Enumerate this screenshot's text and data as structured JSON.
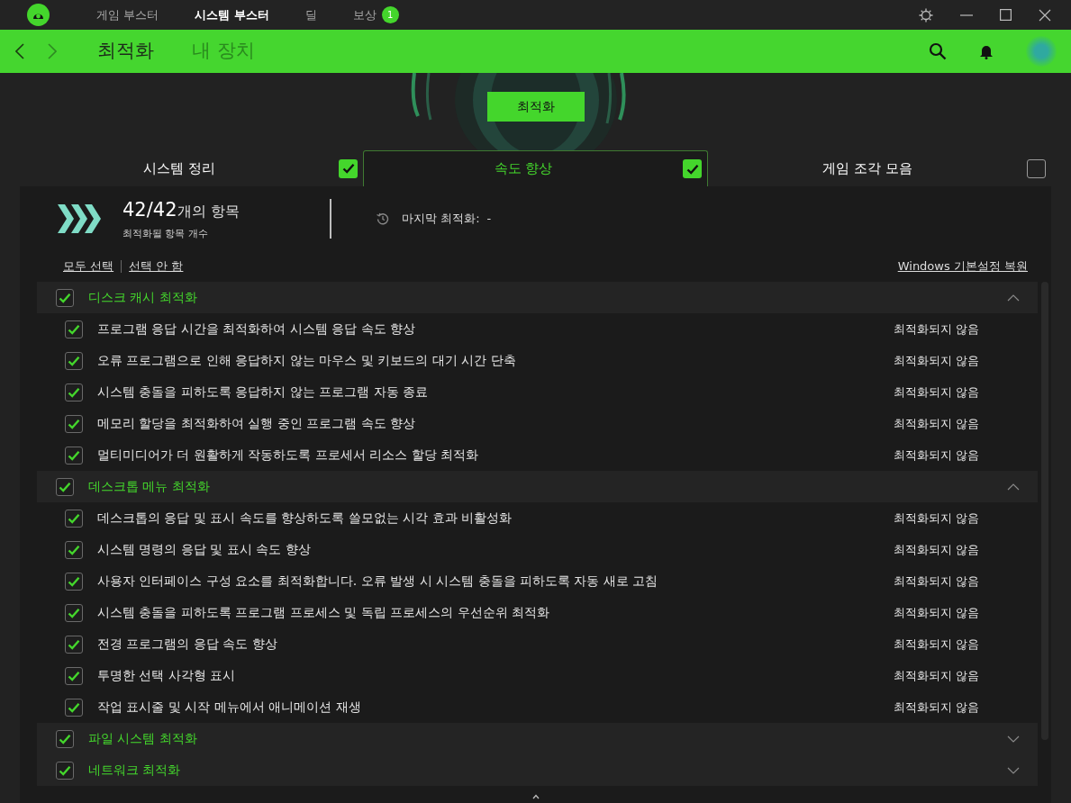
{
  "top_nav": [
    {
      "label": "게임 부스터",
      "selected": false
    },
    {
      "label": "시스템 부스터",
      "selected": true
    },
    {
      "label": "딜",
      "selected": false
    },
    {
      "label": "보상",
      "selected": false,
      "badge": "1"
    }
  ],
  "sub_nav": [
    {
      "label": "최적화",
      "selected": true
    },
    {
      "label": "내 장치",
      "selected": false
    }
  ],
  "optimize_button": "최적화",
  "tabs": [
    {
      "label": "시스템 정리",
      "selected": false,
      "checked": true
    },
    {
      "label": "속도 향상",
      "selected": true,
      "checked": true
    },
    {
      "label": "게임 조각 모음",
      "selected": false,
      "checked": false
    }
  ],
  "summary": {
    "count": "42/42",
    "count_suffix": "개의 항목",
    "caption": "최적화될 항목 개수",
    "last_label": "마지막 최적화:",
    "last_value": "-"
  },
  "links": {
    "select_all": "모두 선택",
    "select_none": "선택 안 함",
    "restore": "Windows 기본설정 복원"
  },
  "groups": [
    {
      "title": "디스크 캐시 최적화",
      "checked": true,
      "expanded": true,
      "items": [
        {
          "label": "프로그램 응답 시간을 최적화하여 시스템 응답 속도 향상",
          "checked": true,
          "status": "최적화되지 않음"
        },
        {
          "label": "오류 프로그램으로 인해 응답하지 않는 마우스 및 키보드의 대기 시간 단축",
          "checked": true,
          "status": "최적화되지 않음"
        },
        {
          "label": "시스템 충돌을 피하도록 응답하지 않는 프로그램 자동 종료",
          "checked": true,
          "status": "최적화되지 않음"
        },
        {
          "label": "메모리 할당을 최적화하여 실행 중인 프로그램 속도 향상",
          "checked": true,
          "status": "최적화되지 않음"
        },
        {
          "label": "멀티미디어가 더 원활하게 작동하도록 프로세서 리소스 할당 최적화",
          "checked": true,
          "status": "최적화되지 않음"
        }
      ]
    },
    {
      "title": "데스크톱 메뉴 최적화",
      "checked": true,
      "expanded": true,
      "items": [
        {
          "label": "데스크톱의 응답 및 표시 속도를 향상하도록 쓸모없는 시각 효과 비활성화",
          "checked": true,
          "status": "최적화되지 않음"
        },
        {
          "label": "시스템 명령의 응답 및 표시 속도 향상",
          "checked": true,
          "status": "최적화되지 않음"
        },
        {
          "label": "사용자 인터페이스 구성 요소를 최적화합니다. 오류 발생 시 시스템 충돌을 피하도록 자동 새로 고침",
          "checked": true,
          "status": "최적화되지 않음"
        },
        {
          "label": "시스템 충돌을 피하도록 프로그램 프로세스 및 독립 프로세스의 우선순위 최적화",
          "checked": true,
          "status": "최적화되지 않음"
        },
        {
          "label": "전경 프로그램의 응답 속도 향상",
          "checked": true,
          "status": "최적화되지 않음"
        },
        {
          "label": "투명한 선택 사각형 표시",
          "checked": true,
          "status": "최적화되지 않음"
        },
        {
          "label": "작업 표시줄 및 시작 메뉴에서 애니메이션 재생",
          "checked": true,
          "status": "최적화되지 않음"
        }
      ]
    },
    {
      "title": "파일 시스템 최적화",
      "checked": true,
      "expanded": false
    },
    {
      "title": "네트워크 최적화",
      "checked": true,
      "expanded": false
    }
  ]
}
